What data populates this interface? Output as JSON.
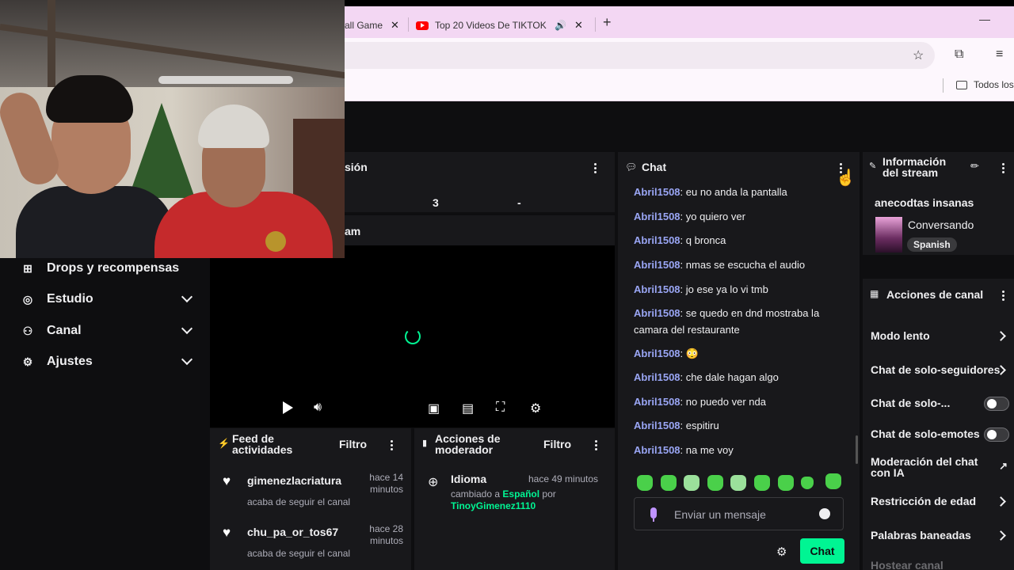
{
  "browser": {
    "tabs": [
      {
        "title": "all Game"
      },
      {
        "title": "Top 20 Videos De TIKTOK M"
      }
    ],
    "bookmark_folder": "Todos los"
  },
  "nav": {
    "items": [
      {
        "label": "Drops y recompensas",
        "icon": "gift-icon"
      },
      {
        "label": "Estudio",
        "icon": "camera-icon"
      },
      {
        "label": "Canal",
        "icon": "people-icon"
      },
      {
        "label": "Ajustes",
        "icon": "gear-icon"
      }
    ]
  },
  "session": {
    "title": "sión",
    "value1": "3",
    "value2": "-"
  },
  "stream_preview": {
    "title": "am"
  },
  "feed": {
    "title_line1": "Feed de",
    "title_line2": "actividades",
    "filter": "Filtro",
    "items": [
      {
        "user": "gimenezlacriatura",
        "time_line1": "hace 14",
        "time_line2": "minutos",
        "action": "acaba de seguir el canal"
      },
      {
        "user": "chu_pa_or_tos67",
        "time_line1": "hace 28",
        "time_line2": "minutos",
        "action": "acaba de seguir el canal"
      }
    ]
  },
  "mod": {
    "title_line1": "Acciones de",
    "title_line2": "moderador",
    "filter": "Filtro",
    "item": {
      "title": "Idioma",
      "time": "hace 49 minutos",
      "desc_prefix": "cambiado a",
      "lang": "Español",
      "desc_by": "por",
      "user": "TinoyGimenez1110"
    }
  },
  "chat": {
    "title": "Chat",
    "messages": [
      {
        "user": "Abril1508",
        "text": "eu no anda la pantalla"
      },
      {
        "user": "Abril1508",
        "text": "yo quiero ver"
      },
      {
        "user": "Abril1508",
        "text": "q bronca"
      },
      {
        "user": "Abril1508",
        "text": "nmas se escucha el audio"
      },
      {
        "user": "Abril1508",
        "text": "jo ese ya lo vi tmb"
      },
      {
        "user": "Abril1508",
        "text": "se quedo en dnd mostraba la camara del restaurante"
      },
      {
        "user": "Abril1508",
        "text": "😳"
      },
      {
        "user": "Abril1508",
        "text": "che dale hagan algo"
      },
      {
        "user": "Abril1508",
        "text": "no puedo ver nda"
      },
      {
        "user": "Abril1508",
        "text": "espitiru"
      },
      {
        "user": "Abril1508",
        "text": "na me voy"
      }
    ],
    "input_placeholder": "Enviar un mensaje",
    "send_label": "Chat"
  },
  "info": {
    "title_line1": "Información",
    "title_line2": "del stream",
    "stream_title": "anecodtas insanas",
    "category": "Conversando",
    "language": "Spanish"
  },
  "actions": {
    "title": "Acciones de canal",
    "items": [
      {
        "label": "Modo lento"
      },
      {
        "label": "Chat de solo-seguidores"
      },
      {
        "label": "Chat de solo-..."
      },
      {
        "label": "Chat de solo-emotes"
      },
      {
        "label": "Moderación del chat con IA"
      },
      {
        "label": "Restricción de edad"
      },
      {
        "label": "Palabras baneadas"
      },
      {
        "label": "Hostear canal"
      }
    ]
  },
  "colors": {
    "accent": "#00f593",
    "username": "#9aa6f5",
    "brand_purple": "#bf94ff"
  }
}
